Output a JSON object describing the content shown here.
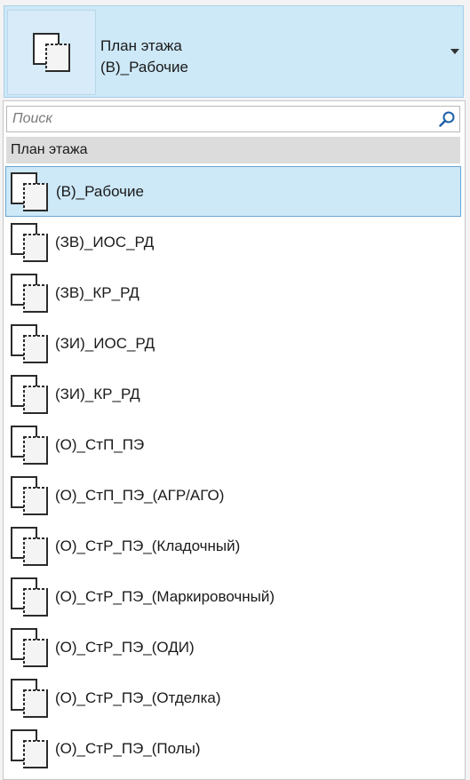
{
  "selector": {
    "family": "План этажа",
    "type": "(В)_Рабочие",
    "icon": "floor-plan-icon",
    "caret_icon": "chevron-down-icon"
  },
  "dropdown": {
    "search": {
      "placeholder": "Поиск",
      "value": "",
      "icon": "search-icon"
    },
    "group_header": "План этажа",
    "items": [
      {
        "label": "(В)_Рабочие",
        "selected": true
      },
      {
        "label": "(ЗВ)_ИОС_РД",
        "selected": false
      },
      {
        "label": "(ЗВ)_КР_РД",
        "selected": false
      },
      {
        "label": "(ЗИ)_ИОС_РД",
        "selected": false
      },
      {
        "label": "(ЗИ)_КР_РД",
        "selected": false
      },
      {
        "label": "(О)_СтП_ПЭ",
        "selected": false
      },
      {
        "label": "(О)_СтП_ПЭ_(АГР/АГО)",
        "selected": false
      },
      {
        "label": "(О)_СтР_ПЭ_(Кладочный)",
        "selected": false
      },
      {
        "label": "(О)_СтР_ПЭ_(Маркировочный)",
        "selected": false
      },
      {
        "label": "(О)_СтР_ПЭ_(ОДИ)",
        "selected": false
      },
      {
        "label": "(О)_СтР_ПЭ_(Отделка)",
        "selected": false
      },
      {
        "label": "(О)_СтР_ПЭ_(Полы)",
        "selected": false
      }
    ]
  },
  "colors": {
    "selection_bg": "#cde8f7",
    "selection_border": "#6aa6d4",
    "group_header_bg": "#dcdcdc",
    "search_icon": "#1d5fa8"
  }
}
